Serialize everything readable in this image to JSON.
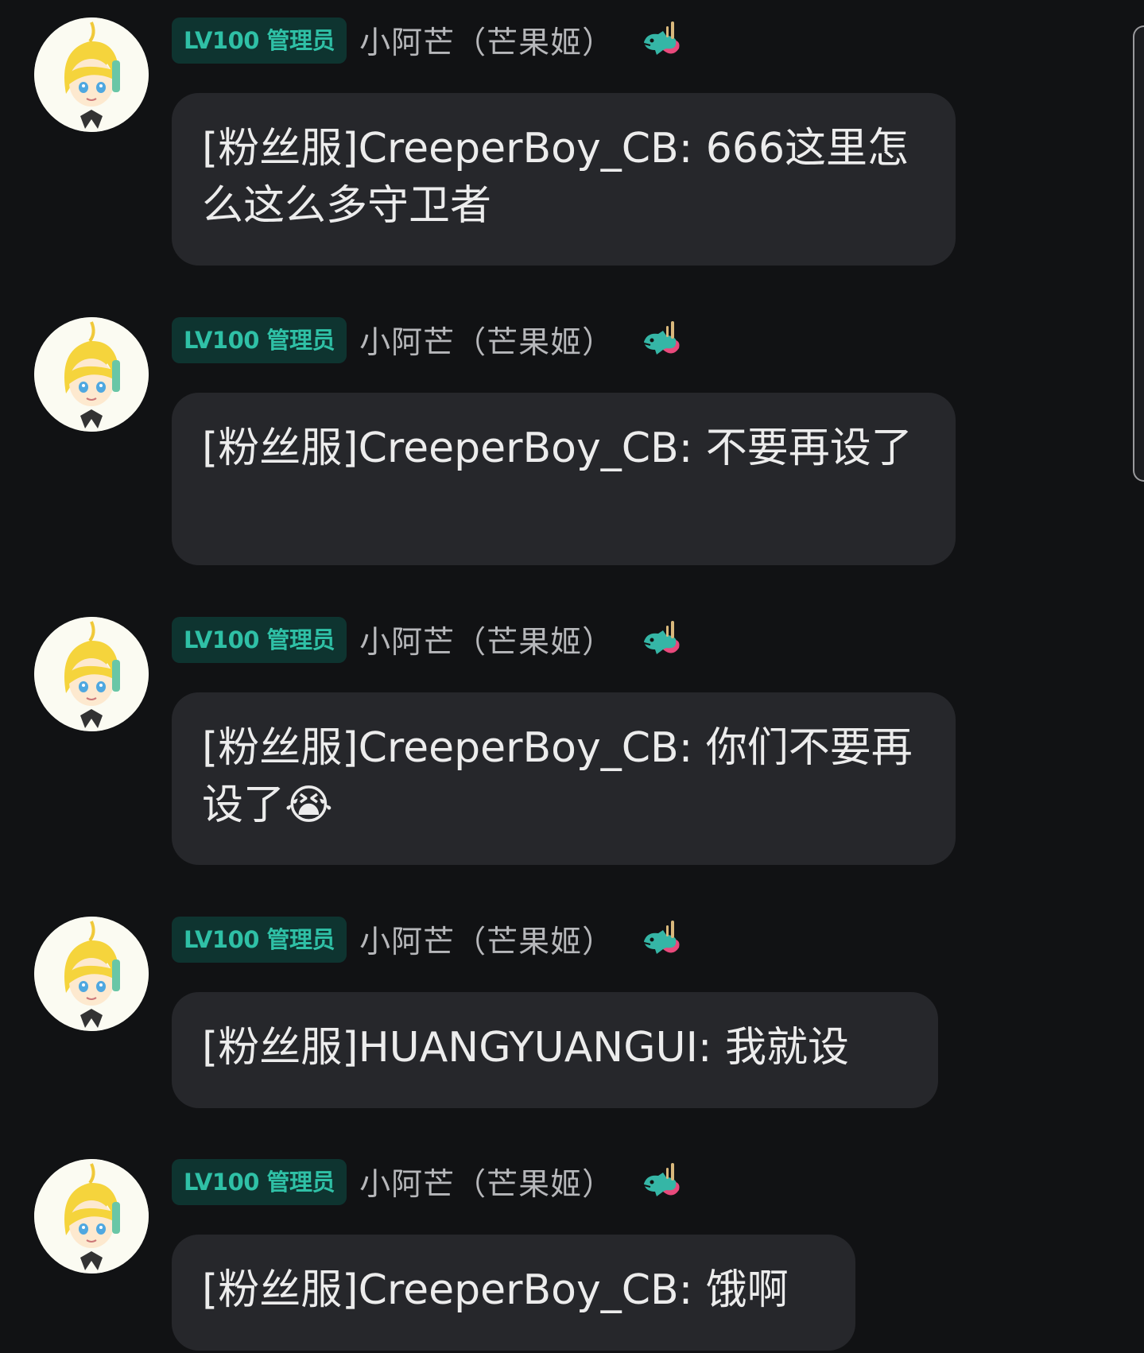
{
  "messages": [
    {
      "badge": "LV100 管理员",
      "sender": "小阿芒（芒果姬）",
      "text": "[粉丝服]CreeperBoy_CB: 666这里怎么这么多守卫者"
    },
    {
      "badge": "LV100 管理员",
      "sender": "小阿芒（芒果姬）",
      "text": "[粉丝服]CreeperBoy_CB: 不要再设了"
    },
    {
      "badge": "LV100 管理员",
      "sender": "小阿芒（芒果姬）",
      "text": "[粉丝服]CreeperBoy_CB: 你们不要再设了😭"
    },
    {
      "badge": "LV100 管理员",
      "sender": "小阿芒（芒果姬）",
      "text": "[粉丝服]HUANGYUANGUI: 我就设"
    },
    {
      "badge": "LV100 管理员",
      "sender": "小阿芒（芒果姬）",
      "text": "[粉丝服]CreeperBoy_CB: 饿啊"
    }
  ],
  "icons": {
    "avatar": "anime-avatar-icon",
    "role": "dragon-icon"
  },
  "colors": {
    "background": "#111214",
    "bubble": "#26272b",
    "badge_bg": "#0e3430",
    "badge_text": "#2fc0a6",
    "sender_text": "#b6b7ba"
  }
}
